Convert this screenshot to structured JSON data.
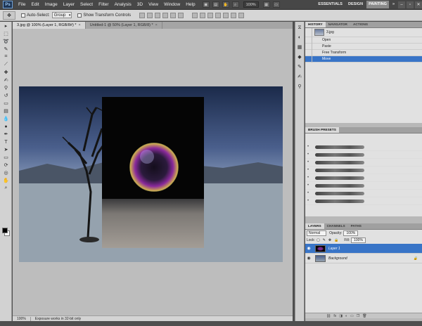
{
  "app": {
    "logo": "Ps"
  },
  "menu": {
    "items": [
      "File",
      "Edit",
      "Image",
      "Layer",
      "Select",
      "Filter",
      "Analysis",
      "3D",
      "View",
      "Window",
      "Help"
    ]
  },
  "menubar_extra": {
    "zoom": "100%"
  },
  "workspaces": {
    "items": [
      "ESSENTIALS",
      "DESIGN",
      "PAINTING"
    ],
    "more": "»"
  },
  "options": {
    "auto_select_label": "Auto-Select:",
    "auto_select_value": "Group",
    "show_transform_label": "Show Transform Controls"
  },
  "tabs": [
    {
      "label": "3.jpg @ 100% (Layer 1, RGB/8#) *",
      "close": "×"
    },
    {
      "label": "Untitled-1 @ 50% (Layer 1, RGB/8) *",
      "close": "×"
    }
  ],
  "status": {
    "zoom": "100%",
    "message": "Exposure works in 32-bit only"
  },
  "history": {
    "tabs": [
      "HISTORY",
      "NAVIGATOR",
      "ACTIONS"
    ],
    "snapshot": "3.jpg",
    "items": [
      "Open",
      "Paste",
      "Free Transform",
      "Move"
    ]
  },
  "brush_presets": {
    "tab": "BRUSH PRESETS",
    "count": 8
  },
  "layers": {
    "tabs": [
      "LAYERS",
      "CHANNELS",
      "PATHS"
    ],
    "blend_mode": "Normal",
    "opacity_label": "Opacity:",
    "opacity": "100%",
    "lock_label": "Lock:",
    "fill_label": "Fill:",
    "fill": "100%",
    "items": [
      "Layer 1",
      "Background"
    ]
  },
  "colors": {
    "selection": "#3874c7",
    "panel_bg": "#e1e1e1",
    "canvas_bg": "#bdbdbd"
  }
}
